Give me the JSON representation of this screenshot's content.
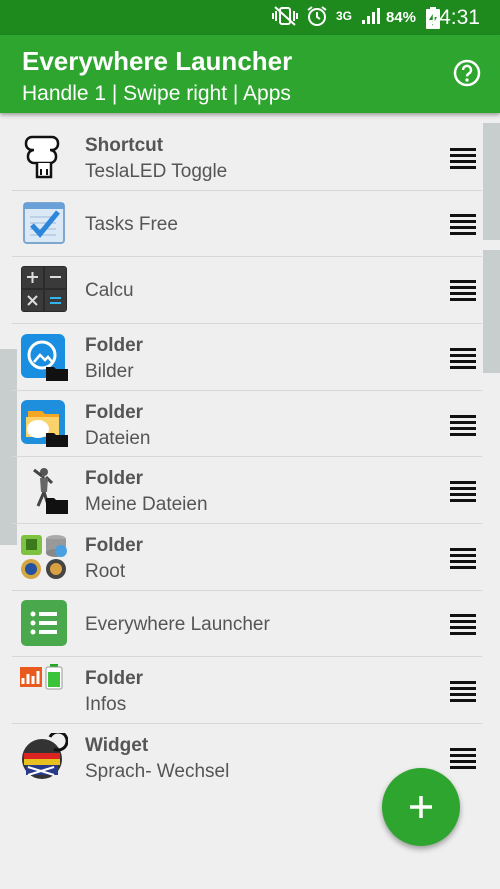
{
  "status": {
    "network": "3G",
    "battery": "84%",
    "time": "14:31"
  },
  "appbar": {
    "title": "Everywhere Launcher",
    "subtitle": "Handle 1 | Swipe right | Apps",
    "help_icon": "help-circle-icon"
  },
  "items": [
    {
      "title": "Shortcut",
      "subtitle": "TeslaLED Toggle",
      "icon": "lightbulb-icon"
    },
    {
      "title": "",
      "subtitle": "Tasks Free",
      "icon": "tasks-icon"
    },
    {
      "title": "",
      "subtitle": "Calcu",
      "icon": "calculator-icon"
    },
    {
      "title": "Folder",
      "subtitle": "Bilder",
      "icon": "gallery-folder-icon"
    },
    {
      "title": "Folder",
      "subtitle": "Dateien",
      "icon": "files-folder-icon"
    },
    {
      "title": "Folder",
      "subtitle": "Meine Dateien",
      "icon": "my-files-folder-icon"
    },
    {
      "title": "Folder",
      "subtitle": "Root",
      "icon": "root-folder-icon"
    },
    {
      "title": "",
      "subtitle": "Everywhere Launcher",
      "icon": "launcher-icon"
    },
    {
      "title": "Folder",
      "subtitle": "Infos",
      "icon": "infos-folder-icon"
    },
    {
      "title": "Widget",
      "subtitle": "Sprach- Wechsel",
      "icon": "flags-widget-icon"
    }
  ],
  "fab": {
    "icon": "plus-icon"
  },
  "colors": {
    "statusbar": "#1e8a1e",
    "appbar": "#2ea52e",
    "fab": "#2ea52e"
  }
}
